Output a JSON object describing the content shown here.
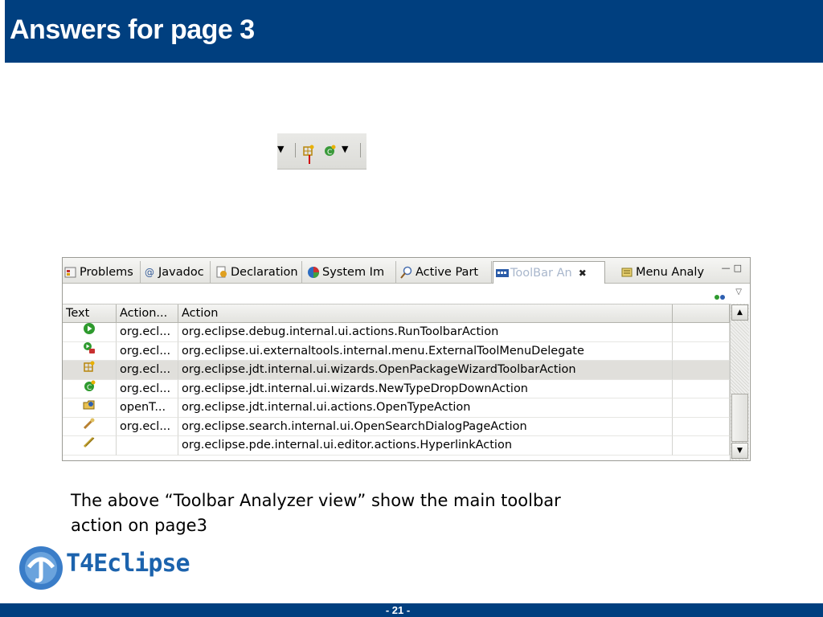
{
  "title": "Answers for page 3",
  "toolbar_crop": {
    "icons": [
      "dropdown-arrow-icon",
      "package-wizard-icon",
      "new-type-icon",
      "dropdown-arrow-icon"
    ]
  },
  "view": {
    "tabs": [
      {
        "label": "Problems",
        "icon": "problems-icon"
      },
      {
        "label": "Javadoc",
        "icon": "javadoc-icon"
      },
      {
        "label": "Declaration",
        "icon": "declaration-icon"
      },
      {
        "label": "System Im",
        "icon": "pie-chart-icon"
      },
      {
        "label": "Active Part",
        "icon": "active-part-icon"
      },
      {
        "label": "ToolBar An",
        "icon": "toolbar-analyzer-icon",
        "active": true
      },
      {
        "label": "Menu Analy",
        "icon": "menu-analyzer-icon"
      }
    ],
    "columns": [
      "Text",
      "Action...",
      "Action",
      ""
    ],
    "rows": [
      {
        "icon": "run-icon",
        "action_short": "org.ecl...",
        "action": "org.eclipse.debug.internal.ui.actions.RunToolbarAction"
      },
      {
        "icon": "external-tool-icon",
        "action_short": "org.ecl...",
        "action": "org.eclipse.ui.externaltools.internal.menu.ExternalToolMenuDelegate"
      },
      {
        "icon": "package-wizard-icon",
        "action_short": "org.ecl...",
        "action": "org.eclipse.jdt.internal.ui.wizards.OpenPackageWizardToolbarAction",
        "selected": true
      },
      {
        "icon": "new-class-icon",
        "action_short": "org.ecl...",
        "action": "org.eclipse.jdt.internal.ui.wizards.NewTypeDropDownAction"
      },
      {
        "icon": "open-type-icon",
        "action_short": "openT...",
        "action": "org.eclipse.jdt.internal.ui.actions.OpenTypeAction"
      },
      {
        "icon": "search-icon",
        "action_short": "org.ecl...",
        "action": "org.eclipse.search.internal.ui.OpenSearchDialogPageAction"
      },
      {
        "icon": "hyperlink-icon",
        "action_short": "",
        "action": "org.eclipse.pde.internal.ui.editor.actions.HyperlinkAction"
      }
    ]
  },
  "caption": {
    "line1": "The above “Toolbar Analyzer view” show the main toolbar",
    "line2": "action on page3"
  },
  "logo_text": "T4Eclipse",
  "page_number": "- 21 -",
  "colors": {
    "brand_blue": "#003f7f",
    "logo_blue": "#1c63ad",
    "selected_row": "#e0dfdb"
  }
}
